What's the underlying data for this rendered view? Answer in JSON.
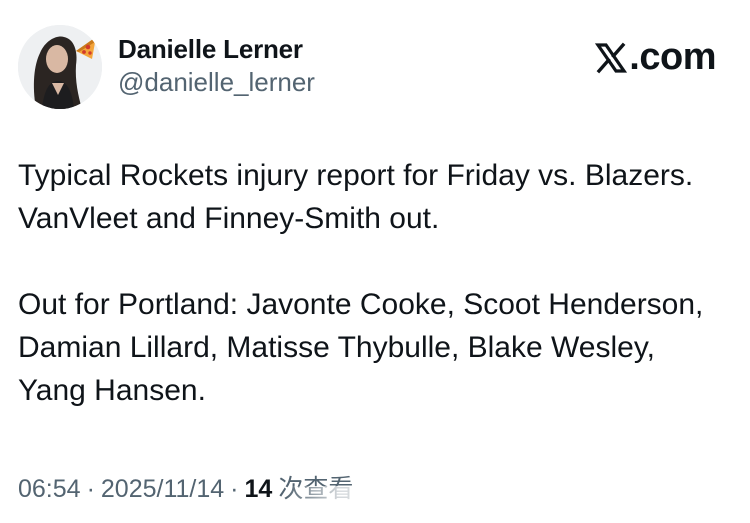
{
  "author": {
    "display_name": "Danielle Lerner",
    "handle": "@danielle_lerner",
    "avatar_icon": "profile-photo-with-pizza-emoji"
  },
  "brand": {
    "label": ".com",
    "icon": "x-logo-icon"
  },
  "tweet": {
    "paragraphs": [
      "Typical Rockets injury report for Friday vs. Blazers. VanVleet and Finney-Smith out.",
      "Out for Portland: Javonte Cooke, Scoot Henderson, Damian Lillard, Matisse Thybulle, Blake Wesley, Yang Hansen."
    ]
  },
  "meta": {
    "time": "06:54",
    "separator": "·",
    "date": "2025/11/14",
    "views_count": "14",
    "views_label": "次查看"
  },
  "colors": {
    "text_primary": "#0f1419",
    "text_secondary": "#536471",
    "background": "#ffffff"
  }
}
